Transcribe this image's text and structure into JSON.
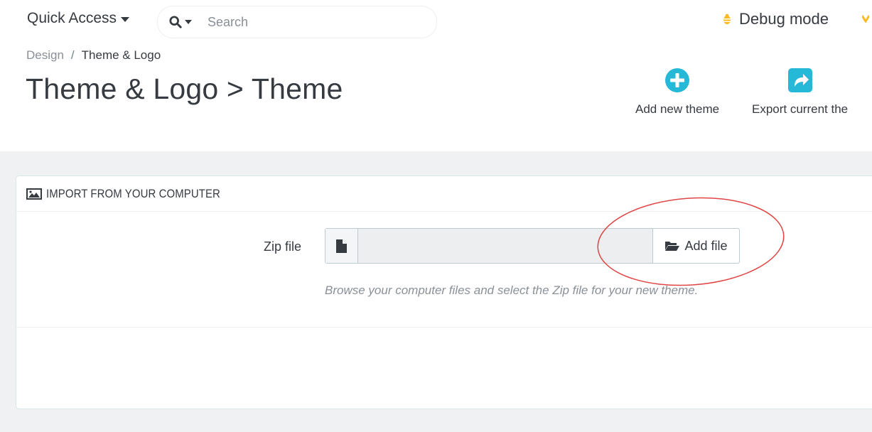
{
  "topbar": {
    "quick_access_label": "Quick Access",
    "search": {
      "placeholder": "Search"
    },
    "debug_label": "Debug mode"
  },
  "breadcrumb": {
    "parent": "Design",
    "separator": "/",
    "current": "Theme & Logo"
  },
  "page_title": "Theme & Logo > Theme",
  "toolbar": {
    "add_new_theme_label": "Add new theme",
    "export_current_theme_label": "Export current the"
  },
  "panel": {
    "heading": "IMPORT FROM YOUR COMPUTER",
    "zip_label": "Zip file",
    "add_file_label": "Add file",
    "help_text": "Browse your computer files and select the Zip file for your new theme."
  },
  "colors": {
    "accent_blue": "#25b9d7",
    "debug_orange": "#fbbb22",
    "annotation_red": "#e04545"
  }
}
